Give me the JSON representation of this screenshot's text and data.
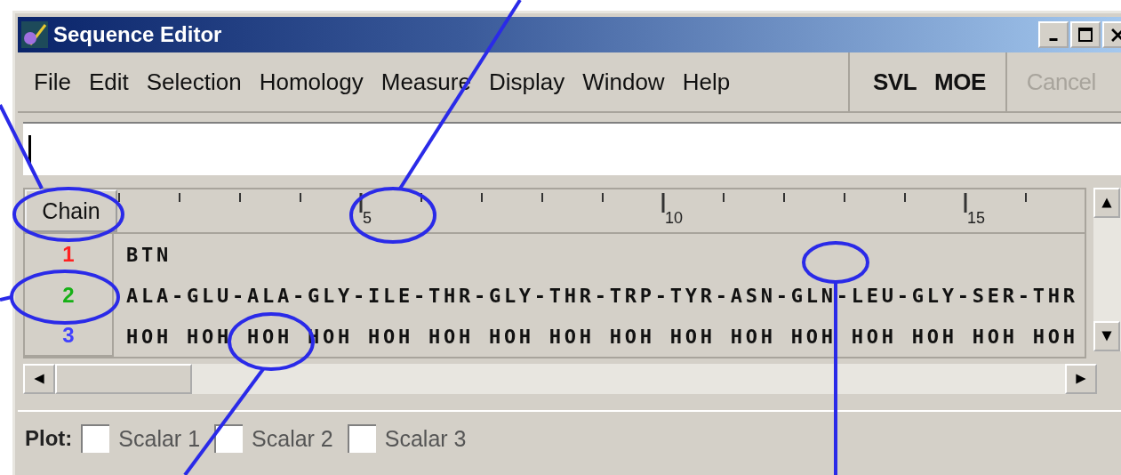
{
  "window": {
    "title": "Sequence Editor"
  },
  "menu": [
    {
      "label": "File"
    },
    {
      "label": "Edit"
    },
    {
      "label": "Selection"
    },
    {
      "label": "Homology"
    },
    {
      "label": "Measure"
    },
    {
      "label": "Display"
    },
    {
      "label": "Window"
    },
    {
      "label": "Help"
    }
  ],
  "toolbar": [
    {
      "label": "SVL",
      "disabled": false
    },
    {
      "label": "MOE",
      "disabled": false
    },
    {
      "label": "Cancel",
      "disabled": true
    }
  ],
  "sequence_panel": {
    "header": "Chain",
    "ruler": [
      "5",
      "10",
      "15"
    ],
    "chains": [
      {
        "number": "1",
        "color": "#ff2020",
        "sequence": "BTN"
      },
      {
        "number": "2",
        "color": "#16b016",
        "sequence": "ALA-GLU-ALA-GLY-ILE-THR-GLY-THR-TRP-TYR-ASN-GLN-LEU-GLY-SER-THR"
      },
      {
        "number": "3",
        "color": "#4040ff",
        "sequence": "HOH HOH HOH HOH HOH HOH HOH HOH HOH HOH HOH HOH HOH HOH HOH HOH"
      }
    ]
  },
  "plot": {
    "label": "Plot:",
    "options": [
      {
        "label": "Scalar 1",
        "checked": false
      },
      {
        "label": "Scalar 2",
        "checked": false
      },
      {
        "label": "Scalar 3",
        "checked": false
      }
    ]
  }
}
